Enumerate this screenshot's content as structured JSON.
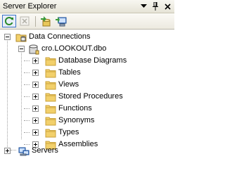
{
  "window": {
    "title": "Server Explorer"
  },
  "titlebar": {
    "dropdown_icon": "chevron-down-icon",
    "pin_icon": "pin-icon",
    "close_icon": "close-icon"
  },
  "toolbar": {
    "tools": [
      {
        "name": "refresh-button",
        "icon": "refresh-icon"
      },
      {
        "name": "stop-refresh-button",
        "icon": "stop-icon",
        "disabled": true
      },
      {
        "name": "connect-to-database-button",
        "icon": "connect-database-icon"
      },
      {
        "name": "connect-to-server-button",
        "icon": "connect-server-icon"
      }
    ]
  },
  "tree": {
    "data_connections": {
      "label": "Data Connections",
      "expanded": true
    },
    "connection": {
      "label": "cro.LOOKOUT.dbo",
      "expanded": true
    },
    "folders": [
      {
        "label": "Database Diagrams"
      },
      {
        "label": "Tables"
      },
      {
        "label": "Views"
      },
      {
        "label": "Stored Procedures"
      },
      {
        "label": "Functions"
      },
      {
        "label": "Synonyms"
      },
      {
        "label": "Types"
      },
      {
        "label": "Assemblies"
      }
    ],
    "servers": {
      "label": "Servers",
      "expanded": false
    }
  },
  "colors": {
    "folder": "#f2d06b",
    "folder_dark": "#c9a23b",
    "accent": "#3b73c8"
  }
}
